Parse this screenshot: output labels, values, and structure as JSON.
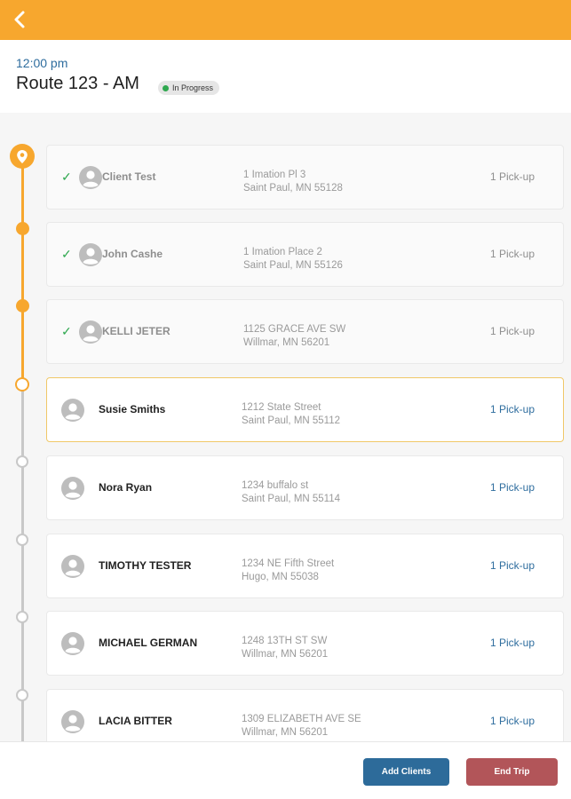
{
  "header": {
    "back_icon": "chevron-left-icon",
    "time": "12:00 pm",
    "route_title": "Route 123 - AM",
    "status": "In Progress",
    "colors": {
      "accent": "#f7a72e",
      "status_dot": "#2fa84f",
      "link": "#2e6d9e"
    }
  },
  "stops": [
    {
      "name": "Client Test",
      "address_line1": "1 Imation Pl 3",
      "address_line2": "Saint Paul, MN 55128",
      "stop_type": "1 Pick-up",
      "state": "completed"
    },
    {
      "name": "John Cashe",
      "address_line1": "1 Imation Place 2",
      "address_line2": "Saint Paul, MN 55126",
      "stop_type": "1 Pick-up",
      "state": "completed"
    },
    {
      "name": "KELLI JETER",
      "address_line1": "1125 GRACE AVE SW",
      "address_line2": "Willmar, MN 56201",
      "stop_type": "1 Pick-up",
      "state": "completed"
    },
    {
      "name": "Susie Smiths",
      "address_line1": "1212 State Street",
      "address_line2": "Saint Paul, MN 55112",
      "stop_type": "1 Pick-up",
      "state": "current"
    },
    {
      "name": "Nora Ryan",
      "address_line1": "1234 buffalo st",
      "address_line2": "Saint Paul, MN 55114",
      "stop_type": "1 Pick-up",
      "state": "upcoming"
    },
    {
      "name": "TIMOTHY TESTER",
      "address_line1": "1234 NE Fifth Street",
      "address_line2": "Hugo, MN 55038",
      "stop_type": "1 Pick-up",
      "state": "upcoming"
    },
    {
      "name": "MICHAEL GERMAN",
      "address_line1": "1248 13TH ST SW",
      "address_line2": "Willmar, MN 56201",
      "stop_type": "1 Pick-up",
      "state": "upcoming"
    },
    {
      "name": "LACIA BITTER",
      "address_line1": "1309 ELIZABETH AVE SE",
      "address_line2": "Willmar, MN 56201",
      "stop_type": "1 Pick-up",
      "state": "upcoming"
    }
  ],
  "footer": {
    "add_clients_label": "Add Clients",
    "end_trip_label": "End Trip",
    "colors": {
      "add_clients": "#2d6b9a",
      "end_trip": "#b25559"
    }
  }
}
